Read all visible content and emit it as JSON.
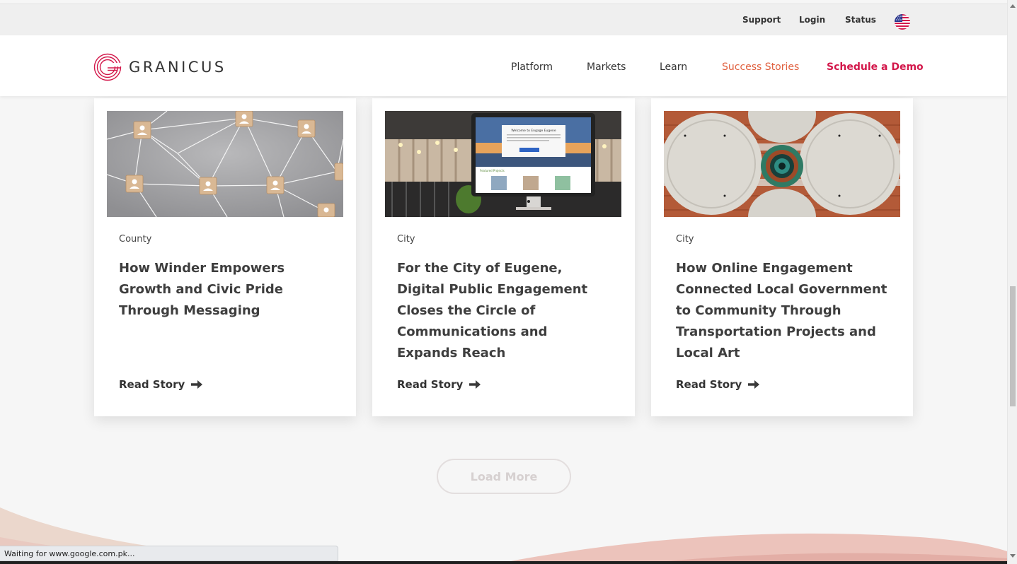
{
  "utility_bar": {
    "support": "Support",
    "login": "Login",
    "status": "Status",
    "locale_icon": "us-flag-icon"
  },
  "nav": {
    "logo_text": "GRANICUS",
    "items": [
      {
        "label": "Platform"
      },
      {
        "label": "Markets"
      },
      {
        "label": "Learn"
      },
      {
        "label": "Success Stories",
        "active": true
      },
      {
        "label": "Schedule a Demo",
        "cta": true
      }
    ]
  },
  "colors": {
    "accent_active": "#e0603f",
    "cta": "#d3184b",
    "wave_light": "#ebd7cc",
    "wave_pink": "#e8b8b0"
  },
  "cards": [
    {
      "category": "County",
      "title": "How Winder Empowers Growth and Civic Pride Through Messaging",
      "cta": "Read Story",
      "image": "network-of-people-blocks"
    },
    {
      "category": "City",
      "title": "For the City of Eugene, Digital Public Engagement Closes the Circle of Communications and Expands Reach",
      "cta": "Read Story",
      "image": "computer-monitor-in-office",
      "monitor_heading": "Welcome to Engage Eugene",
      "monitor_section": "Featured Projects"
    },
    {
      "category": "City",
      "title": "How Online Engagement Connected Local Government to Community Through Transportation Projects and Local Art",
      "cta": "Read Story",
      "image": "aerial-street-art-mural"
    }
  ],
  "load_more": "Load More",
  "browser_status": "Waiting for www.google.com.pk..."
}
